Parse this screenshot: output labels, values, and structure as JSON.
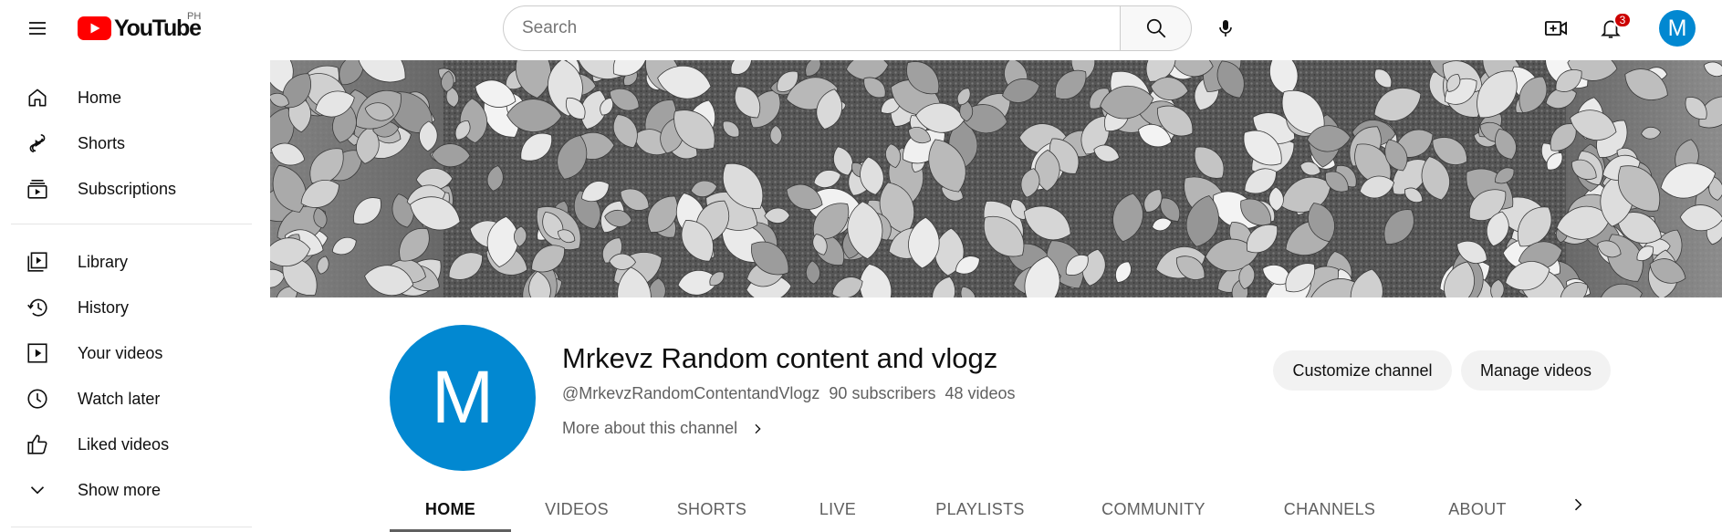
{
  "header": {
    "logo_text": "YouTube",
    "country_code": "PH",
    "search_placeholder": "Search",
    "notification_count": "3",
    "avatar_initial": "M"
  },
  "sidebar": {
    "items": [
      {
        "label": "Home",
        "icon": "home-icon"
      },
      {
        "label": "Shorts",
        "icon": "shorts-icon"
      },
      {
        "label": "Subscriptions",
        "icon": "subscriptions-icon"
      },
      {
        "label": "Library",
        "icon": "library-icon"
      },
      {
        "label": "History",
        "icon": "history-icon"
      },
      {
        "label": "Your videos",
        "icon": "your-videos-icon"
      },
      {
        "label": "Watch later",
        "icon": "watch-later-icon"
      },
      {
        "label": "Liked videos",
        "icon": "liked-videos-icon"
      },
      {
        "label": "Show more",
        "icon": "chevron-down-icon"
      }
    ]
  },
  "channel": {
    "avatar_initial": "M",
    "name": "Mrkevz Random content and vlogz",
    "handle": "@MrkevzRandomContentandVlogz",
    "subscribers": "90 subscribers",
    "videos": "48 videos",
    "more_about": "More about this channel",
    "customize_label": "Customize channel",
    "manage_label": "Manage videos"
  },
  "tabs": [
    {
      "label": "HOME",
      "active": true
    },
    {
      "label": "VIDEOS",
      "active": false
    },
    {
      "label": "SHORTS",
      "active": false
    },
    {
      "label": "LIVE",
      "active": false
    },
    {
      "label": "PLAYLISTS",
      "active": false
    },
    {
      "label": "COMMUNITY",
      "active": false
    },
    {
      "label": "CHANNELS",
      "active": false
    },
    {
      "label": "ABOUT",
      "active": false
    }
  ],
  "colors": {
    "brand_red": "#ff0000",
    "avatar_blue": "#0288d1",
    "badge_red": "#cc0000"
  }
}
